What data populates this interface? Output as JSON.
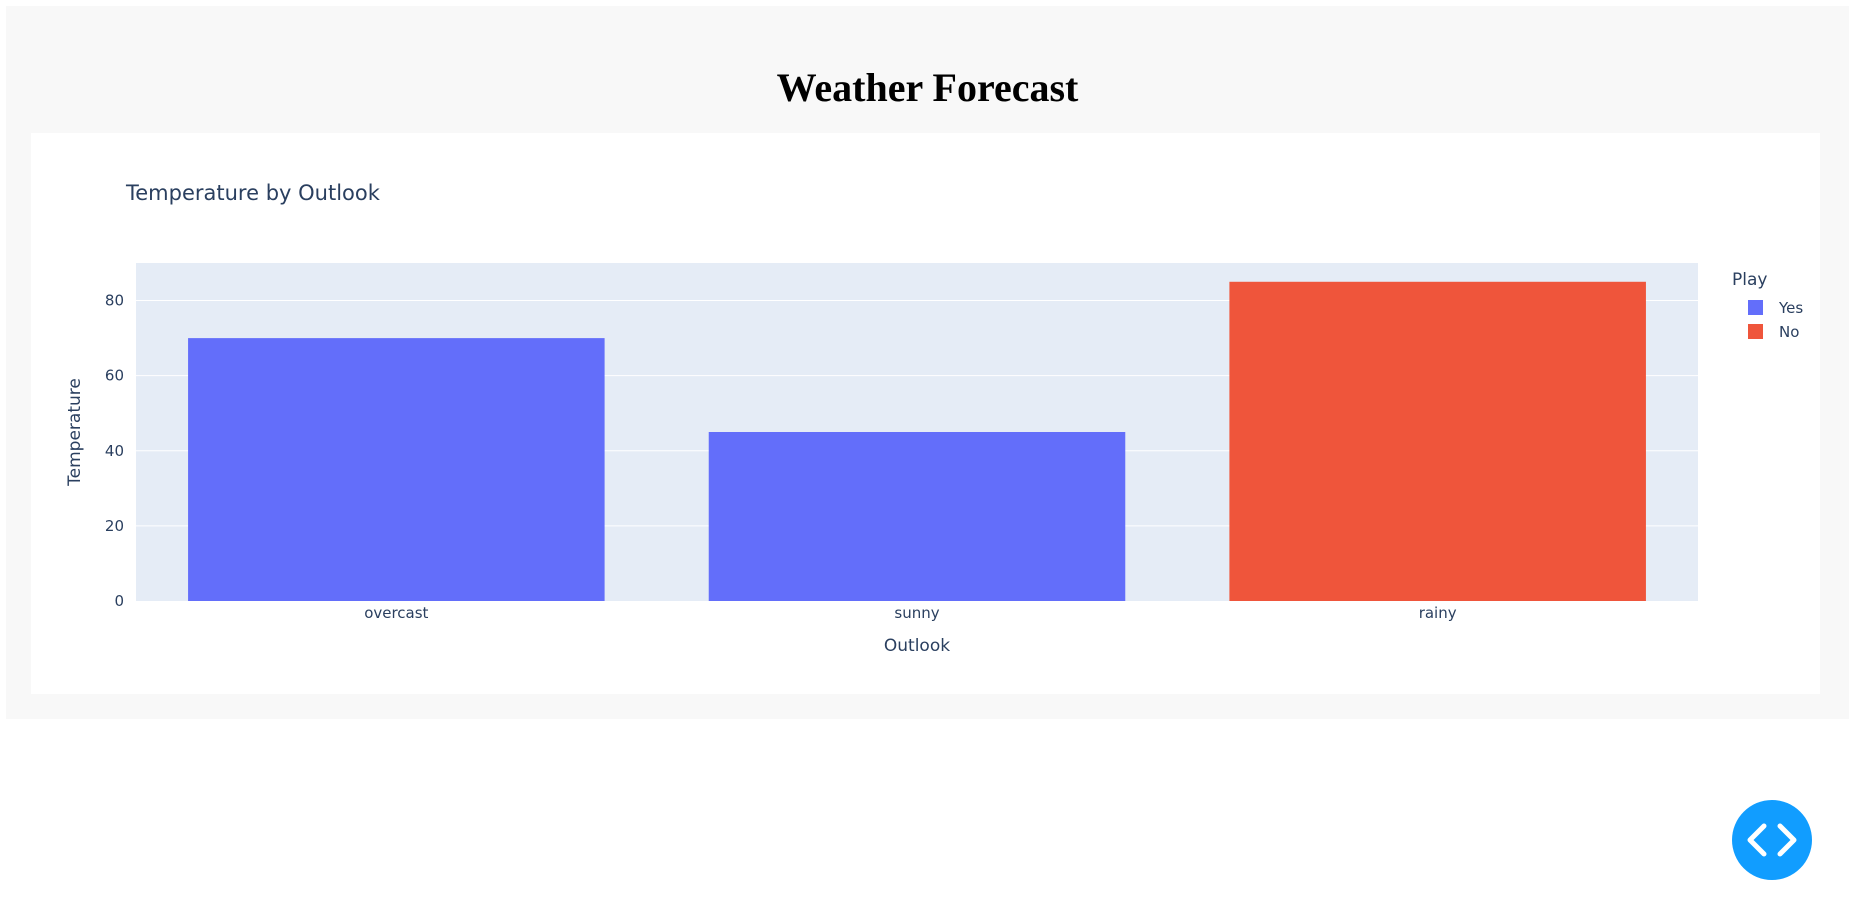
{
  "page": {
    "title": "Weather Forecast"
  },
  "fab": {
    "icon": "code-brackets-icon"
  },
  "colors": {
    "yes": "#636efa",
    "no": "#ef553b",
    "plot_bg": "#e5ecf6",
    "gridline": "#ffffff",
    "text": "#2a3f5f",
    "fab": "#119dff"
  },
  "chart_data": {
    "type": "bar",
    "title": "Temperature by Outlook",
    "xlabel": "Outlook",
    "ylabel": "Temperature",
    "categories": [
      "overcast",
      "sunny",
      "rainy"
    ],
    "ylim": [
      0,
      90
    ],
    "yticks": [
      0,
      20,
      40,
      60,
      80
    ],
    "grid": true,
    "legend": {
      "title": "Play",
      "placement": "top-right",
      "entries": [
        "Yes",
        "No"
      ]
    },
    "series": [
      {
        "name": "Yes",
        "color": "#636efa",
        "values": [
          70,
          45,
          null
        ]
      },
      {
        "name": "No",
        "color": "#ef553b",
        "values": [
          null,
          null,
          85
        ]
      }
    ]
  }
}
